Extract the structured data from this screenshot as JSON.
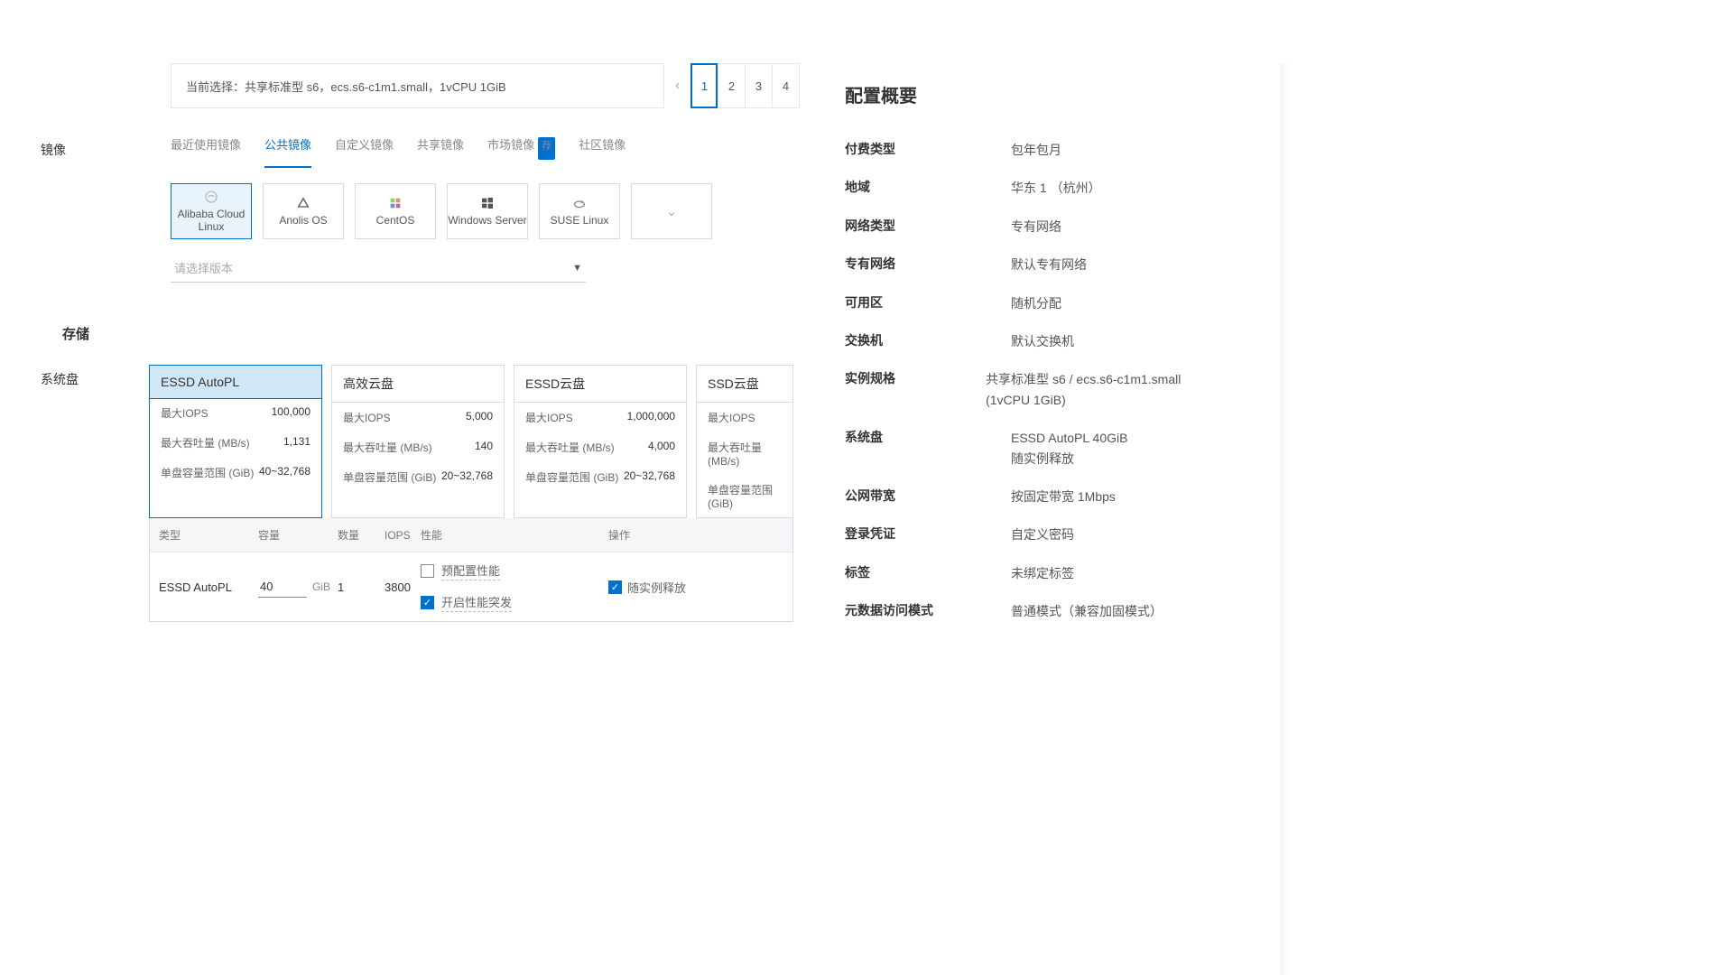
{
  "selection": {
    "label_prefix": "当前选择：",
    "text": "共享标准型 s6，ecs.s6-c1m1.small，1vCPU 1GiB",
    "steps": [
      "1",
      "2",
      "3",
      "4"
    ],
    "active_step": 0
  },
  "image": {
    "label": "镜像",
    "tabs": [
      "最近使用镜像",
      "公共镜像",
      "自定义镜像",
      "共享镜像",
      "市场镜像",
      "社区镜像"
    ],
    "active_tab": 1,
    "market_badge": "荐",
    "os": [
      {
        "name": "Alibaba Cloud Linux",
        "icon": "alibaba"
      },
      {
        "name": "Anolis OS",
        "icon": "anolis"
      },
      {
        "name": "CentOS",
        "icon": "centos"
      },
      {
        "name": "Windows Server",
        "icon": "windows"
      },
      {
        "name": "SUSE Linux",
        "icon": "suse"
      }
    ],
    "selected_os": 0,
    "more_icon": "chevron-down",
    "version_placeholder": "请选择版本"
  },
  "storage": {
    "label": "存储"
  },
  "system_disk": {
    "label": "系统盘",
    "options": [
      {
        "name": "ESSD AutoPL",
        "iops": "100,000",
        "throughput": "1,131",
        "range": "40~32,768"
      },
      {
        "name": "高效云盘",
        "iops": "5,000",
        "throughput": "140",
        "range": "20~32,768"
      },
      {
        "name": "ESSD云盘",
        "iops": "1,000,000",
        "throughput": "4,000",
        "range": "20~32,768"
      },
      {
        "name": "SSD云盘",
        "iops": "",
        "throughput": "",
        "range": ""
      }
    ],
    "spec_labels": {
      "iops": "最大IOPS",
      "throughput": "最大吞吐量 (MB/s)",
      "range": "单盘容量范围 (GiB)"
    },
    "selected": 0,
    "table": {
      "headers": [
        "类型",
        "容量",
        "数量",
        "IOPS",
        "性能",
        "操作"
      ],
      "type": "ESSD AutoPL",
      "capacity": "40",
      "capacity_unit": "GiB",
      "quantity": "1",
      "iops": "3800",
      "perf_pre_label": "预配置性能",
      "perf_pre_checked": false,
      "perf_burst_label": "开启性能突发",
      "perf_burst_checked": true,
      "release_label": "随实例释放",
      "release_checked": true
    }
  },
  "summary": {
    "title": "配置概要",
    "rows": [
      {
        "k": "付费类型",
        "v": "包年包月"
      },
      {
        "k": "地域",
        "v": "华东 1 （杭州）"
      },
      {
        "k": "网络类型",
        "v": "专有网络"
      },
      {
        "k": "专有网络",
        "v": "默认专有网络"
      },
      {
        "k": "可用区",
        "v": "随机分配"
      },
      {
        "k": "交换机",
        "v": "默认交换机"
      },
      {
        "k": "实例规格",
        "v": "共享标准型 s6 / ecs.s6-c1m1.small (1vCPU 1GiB)"
      },
      {
        "k": "系统盘",
        "v": "ESSD AutoPL 40GiB\n随实例释放"
      },
      {
        "k": "公网带宽",
        "v": "按固定带宽 1Mbps"
      },
      {
        "k": "登录凭证",
        "v": "自定义密码"
      },
      {
        "k": "标签",
        "v": "未绑定标签"
      },
      {
        "k": "元数据访问模式",
        "v": "普通模式（兼容加固模式）"
      }
    ]
  }
}
